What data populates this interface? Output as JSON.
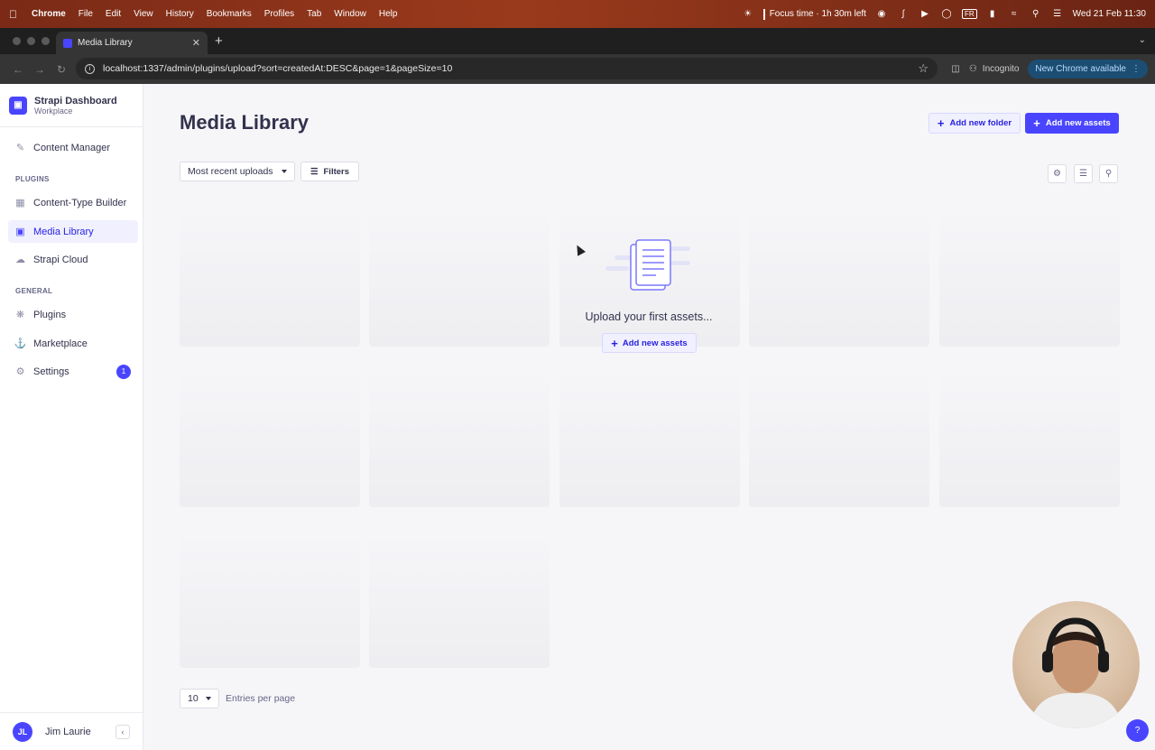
{
  "os_menubar": {
    "app_name": "Chrome",
    "menus": [
      "File",
      "Edit",
      "View",
      "History",
      "Bookmarks",
      "Profiles",
      "Tab",
      "Window",
      "Help"
    ],
    "focus_label": "Focus time · 1h 30m left",
    "input_source": "FR",
    "datetime": "Wed 21 Feb  11:30"
  },
  "browser": {
    "tab_title": "Media Library",
    "url": "localhost:1337/admin/plugins/upload?sort=createdAt:DESC&page=1&pageSize=10",
    "incognito_label": "Incognito",
    "update_label": "New Chrome available"
  },
  "sidebar": {
    "brand_title": "Strapi Dashboard",
    "brand_subtitle": "Workplace",
    "content_manager": "Content Manager",
    "plugins_heading": "PLUGINS",
    "plugins": [
      "Content-Type Builder",
      "Media Library",
      "Strapi Cloud"
    ],
    "active_item": "Media Library",
    "general_heading": "GENERAL",
    "general": [
      "Plugins",
      "Marketplace",
      "Settings"
    ],
    "settings_badge": "1",
    "user_initials": "JL",
    "user_name": "Jim Laurie"
  },
  "main": {
    "title": "Media Library",
    "add_folder_label": "Add new folder",
    "add_assets_label": "Add new assets",
    "sort_value": "Most recent uploads",
    "filters_label": "Filters",
    "empty_text": "Upload your first assets...",
    "empty_button_label": "Add new assets",
    "page_size_value": "10",
    "page_size_label": "Entries per page"
  },
  "colors": {
    "primary": "#4945ff",
    "primary_light": "#f0f0ff",
    "text": "#32324d",
    "muted": "#666687"
  }
}
